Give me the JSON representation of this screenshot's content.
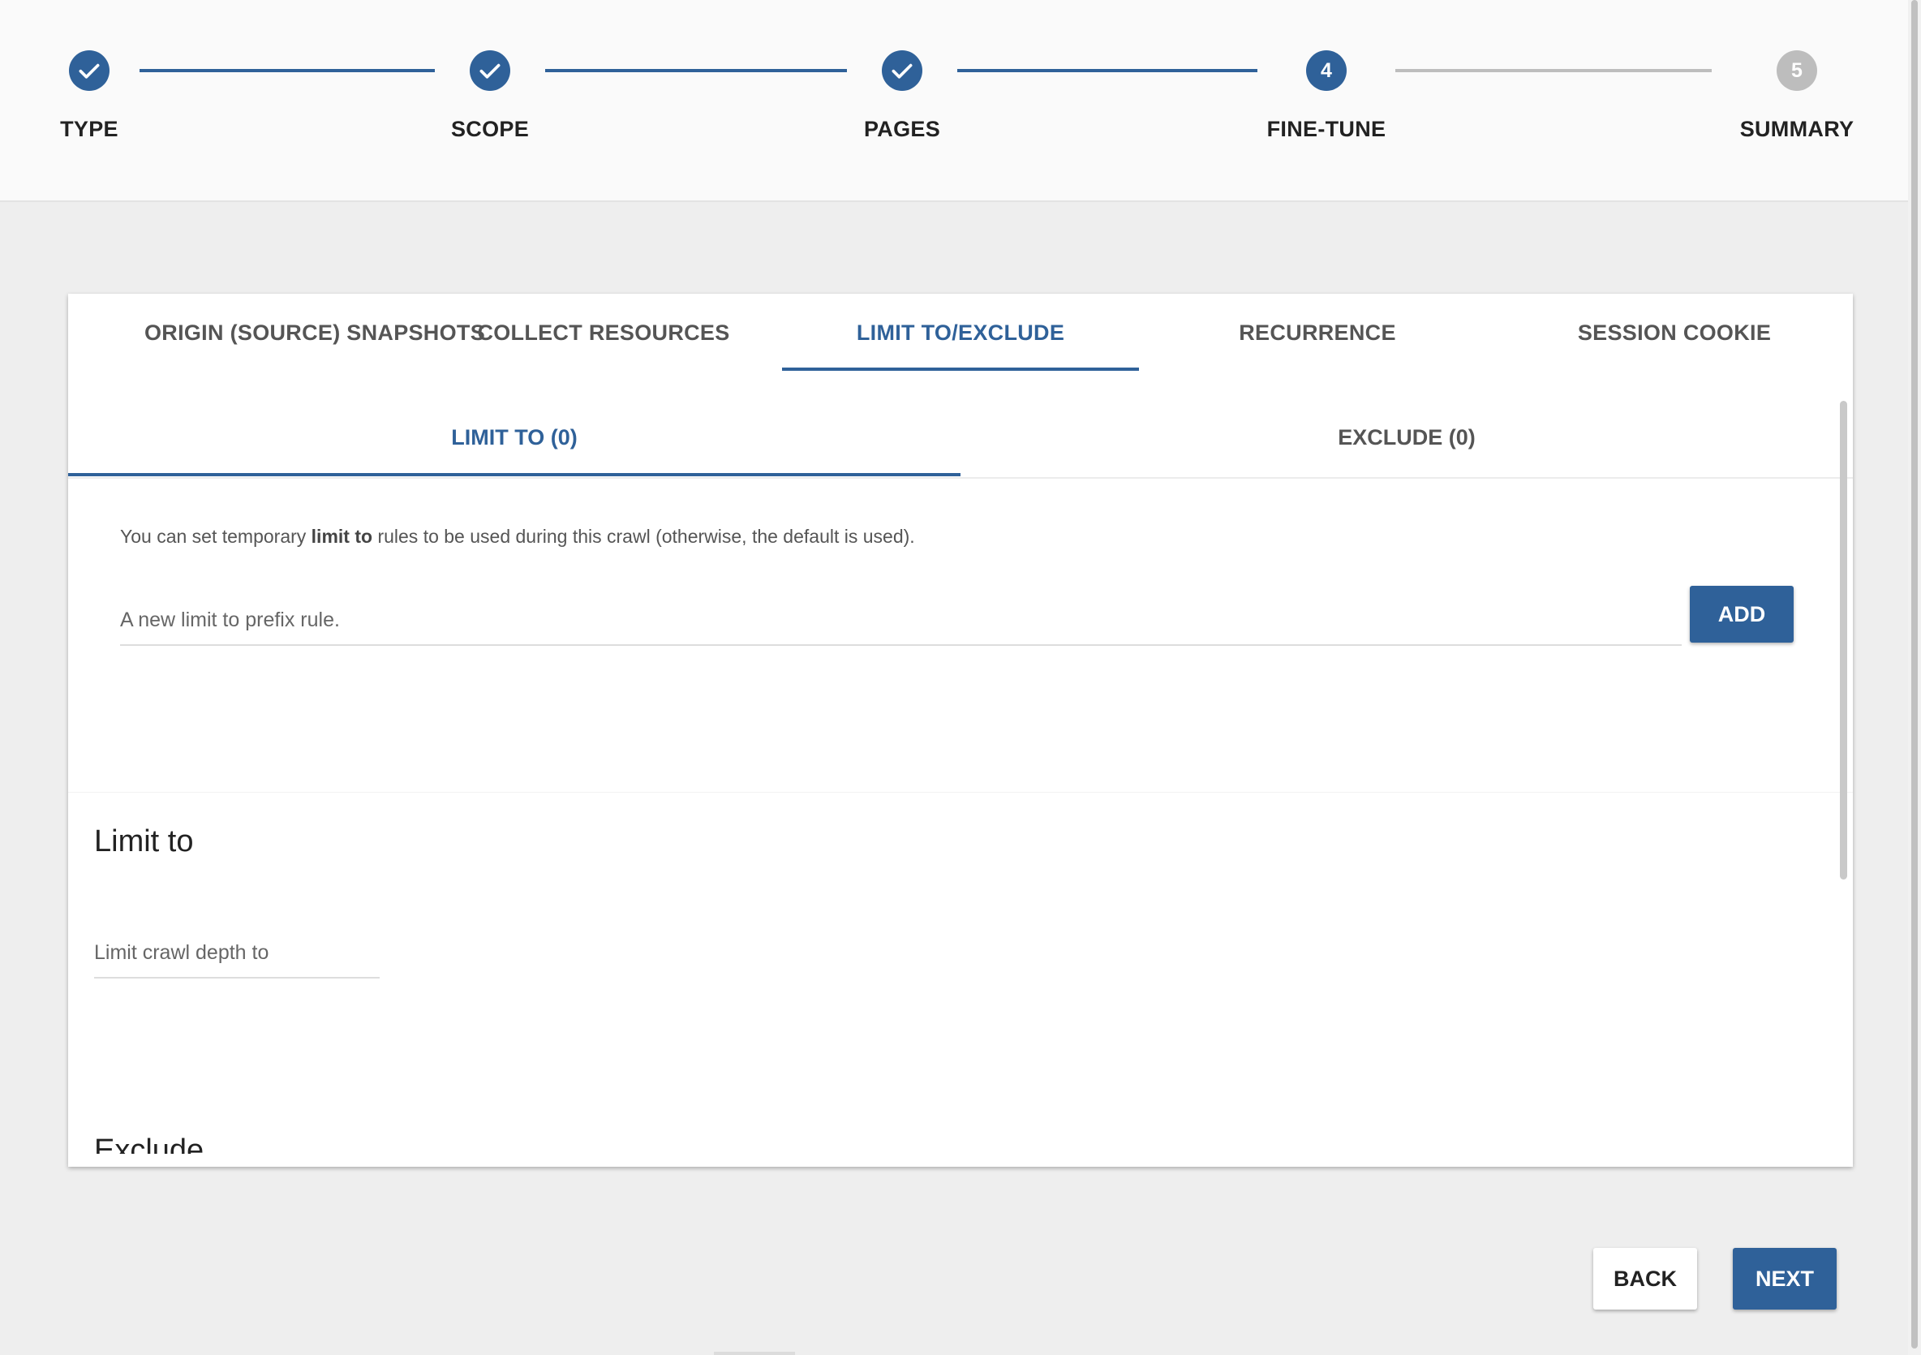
{
  "stepper": {
    "steps": [
      {
        "label": "TYPE",
        "state": "done",
        "icon": "check-icon"
      },
      {
        "label": "SCOPE",
        "state": "done",
        "icon": "check-icon"
      },
      {
        "label": "PAGES",
        "state": "done",
        "icon": "check-icon"
      },
      {
        "label": "FINE-TUNE",
        "state": "current",
        "number": "4"
      },
      {
        "label": "SUMMARY",
        "state": "pending",
        "number": "5"
      }
    ]
  },
  "tabs": [
    {
      "label": "ORIGIN (SOURCE) SNAPSHOTS",
      "active": false
    },
    {
      "label": "COLLECT RESOURCES",
      "active": false
    },
    {
      "label": "LIMIT TO/EXCLUDE",
      "active": true
    },
    {
      "label": "RECURRENCE",
      "active": false
    },
    {
      "label": "SESSION COOKIE",
      "active": false
    }
  ],
  "subtabs": [
    {
      "label": "LIMIT TO (0)",
      "active": true
    },
    {
      "label": "EXCLUDE (0)",
      "active": false
    }
  ],
  "limit_panel": {
    "info_prefix": "You can set temporary ",
    "info_bold": "limit to",
    "info_suffix": " rules to be used during this crawl (otherwise, the default is used).",
    "prefix_placeholder": "A new limit to prefix rule.",
    "prefix_value": "",
    "add_label": "ADD"
  },
  "limit_section": {
    "title": "Limit to",
    "depth_placeholder": "Limit crawl depth to",
    "depth_value": ""
  },
  "exclude_section": {
    "title": "Exclude"
  },
  "footer": {
    "back_label": "BACK",
    "next_label": "NEXT"
  },
  "colors": {
    "accent": "#2f6199",
    "pending": "#bdbdbd",
    "background": "#eeeeee"
  }
}
